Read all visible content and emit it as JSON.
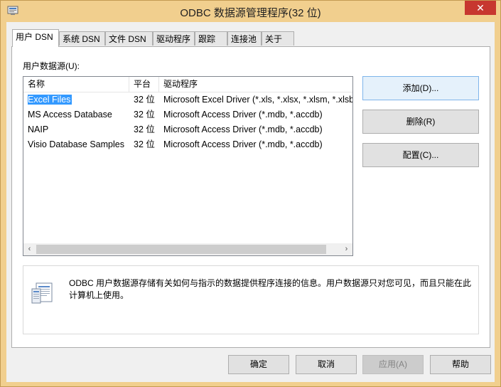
{
  "window": {
    "title": "ODBC 数据源管理程序(32 位)",
    "close_glyph": "✕",
    "tabs": [
      "用户 DSN",
      "系统 DSN",
      "文件 DSN",
      "驱动程序",
      "跟踪",
      "连接池",
      "关于"
    ],
    "active_tab": 0
  },
  "user_dsn": {
    "section_label": "用户数据源(U):",
    "columns": [
      "名称",
      "平台",
      "驱动程序"
    ],
    "rows": [
      {
        "name": "Excel Files",
        "platform": "32 位",
        "driver": "Microsoft Excel Driver (*.xls, *.xlsx, *.xlsm, *.xlsb)"
      },
      {
        "name": "MS Access Database",
        "platform": "32 位",
        "driver": "Microsoft Access Driver (*.mdb, *.accdb)"
      },
      {
        "name": "NAIP",
        "platform": "32 位",
        "driver": "Microsoft Access Driver (*.mdb, *.accdb)"
      },
      {
        "name": "Visio Database Samples",
        "platform": "32 位",
        "driver": "Microsoft Access Driver (*.mdb, *.accdb)"
      }
    ],
    "selected_row": 0,
    "scroll_left": "‹",
    "scroll_right": "›",
    "add_button": "添加(D)...",
    "delete_button": "删除(R)",
    "configure_button": "配置(C)...",
    "info_text": "ODBC 用户数据源存储有关如何与指示的数据提供程序连接的信息。用户数据源只对您可见，而且只能在此计算机上使用。"
  },
  "footer": {
    "ok": "确定",
    "cancel": "取消",
    "apply": "应用(A)",
    "help": "帮助"
  },
  "colors": {
    "frame": "#f1cf8e",
    "close": "#c7372f",
    "selection": "#3399ff"
  }
}
